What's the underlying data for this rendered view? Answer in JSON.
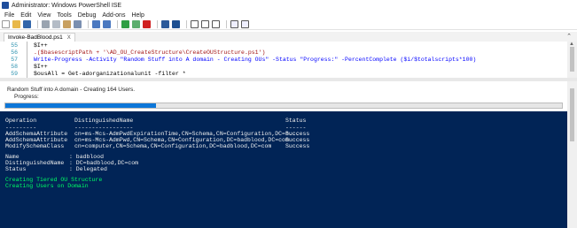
{
  "window": {
    "title": "Administrator: Windows PowerShell ISE"
  },
  "menu": [
    "File",
    "Edit",
    "View",
    "Tools",
    "Debug",
    "Add-ons",
    "Help"
  ],
  "tab": {
    "label": "Invoke-BadBlood.ps1",
    "close": "X"
  },
  "editor": {
    "lines": [
      {
        "num": "55",
        "code": "$I++"
      },
      {
        "num": "56",
        "code": ".($basescriptPath + '\\AD_OU_CreateStructure\\CreateOUStructure.ps1')"
      },
      {
        "num": "57",
        "code": "Write-Progress -Activity \"Random Stuff into A domain - Creating OUs\" -Status \"Progress:\" -PercentComplete ($i/$totalscripts*100)"
      },
      {
        "num": "58",
        "code": "$I++"
      },
      {
        "num": "59",
        "code": "$ousAll = Get-adorganizationalunit -filter *"
      }
    ]
  },
  "progress": {
    "activity": "Random Stuff into A domain - Creating 164 Users.",
    "status": "Progress:",
    "percent": 27
  },
  "console": {
    "header": {
      "operation": "Operation",
      "dn": "DistinguishedName",
      "status": "Status"
    },
    "sep": {
      "operation": "---------",
      "dn": "-----------------",
      "status": "------"
    },
    "rows": [
      {
        "operation": "AddSchemaAttribute",
        "dn": "cn=ms-Mcs-AdmPwdExpirationTime,CN=Schema,CN=Configuration,DC=b...",
        "status": "Success"
      },
      {
        "operation": "AddSchemaAttribute",
        "dn": "cn=ms-Mcs-AdmPwd,CN=Schema,CN=Configuration,DC=badblood,DC=com",
        "status": "Success"
      },
      {
        "operation": "ModifySchemaClass",
        "dn": "cn=computer,CN=Schema,CN=Configuration,DC=badblood,DC=com",
        "status": "Success"
      }
    ],
    "props": [
      {
        "key": "Name",
        "value": ": badblood"
      },
      {
        "key": "DistinguishedName",
        "value": ": DC=badblood,DC=com"
      },
      {
        "key": "Status",
        "value": ": Delegated"
      }
    ],
    "messages": [
      "Creating Tiered OU Structure",
      "Creating Users on Domain"
    ]
  },
  "colors": {
    "console_bg": "#012456",
    "message": "#00ff66",
    "progress_fill": "#0d76d8"
  }
}
